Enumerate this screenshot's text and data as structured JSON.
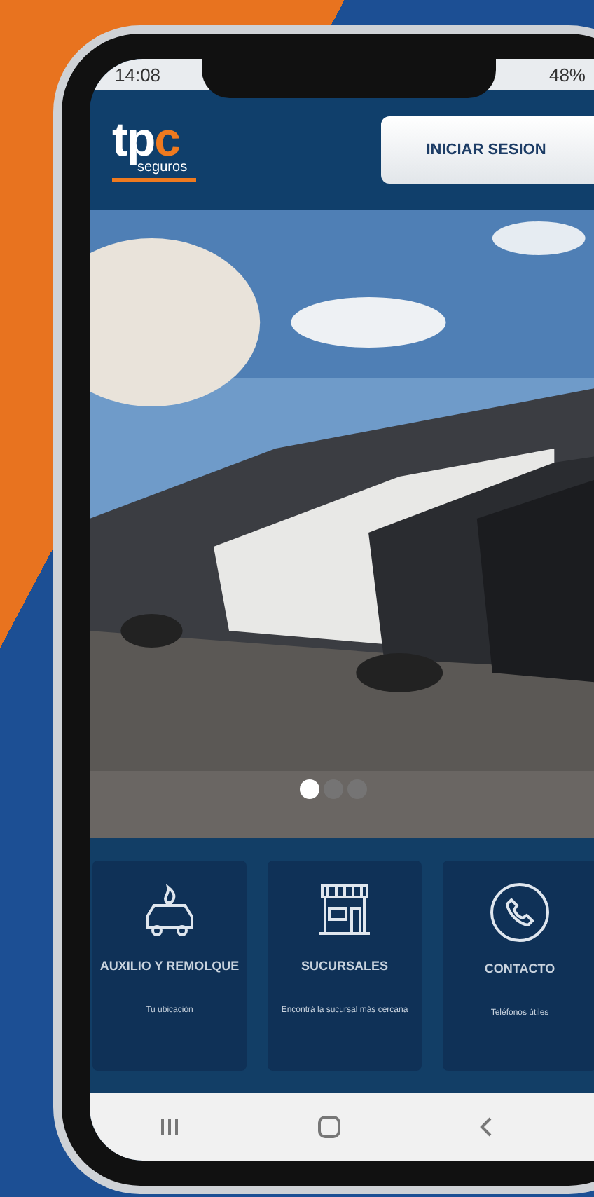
{
  "status_bar": {
    "time": "14:08",
    "battery": "48%"
  },
  "header": {
    "logo": {
      "main": "tp",
      "accent": "c",
      "sub": "seguros"
    },
    "login_button": "INICIAR SESION"
  },
  "carousel": {
    "kind": "picture",
    "dots": [
      {
        "selected": true
      },
      {
        "selected": false
      },
      {
        "selected": false
      }
    ]
  },
  "services": [
    {
      "kind": "car",
      "title": "AUXILIO Y REMOLQUE",
      "subtitle": "Tu ubicación"
    },
    {
      "kind": "store",
      "title": "SUCURSALES",
      "subtitle": "Encontrá la sucursal más cercana"
    },
    {
      "kind": "phone",
      "title": "CONTACTO",
      "subtitle": "Teléfonos útiles"
    }
  ]
}
